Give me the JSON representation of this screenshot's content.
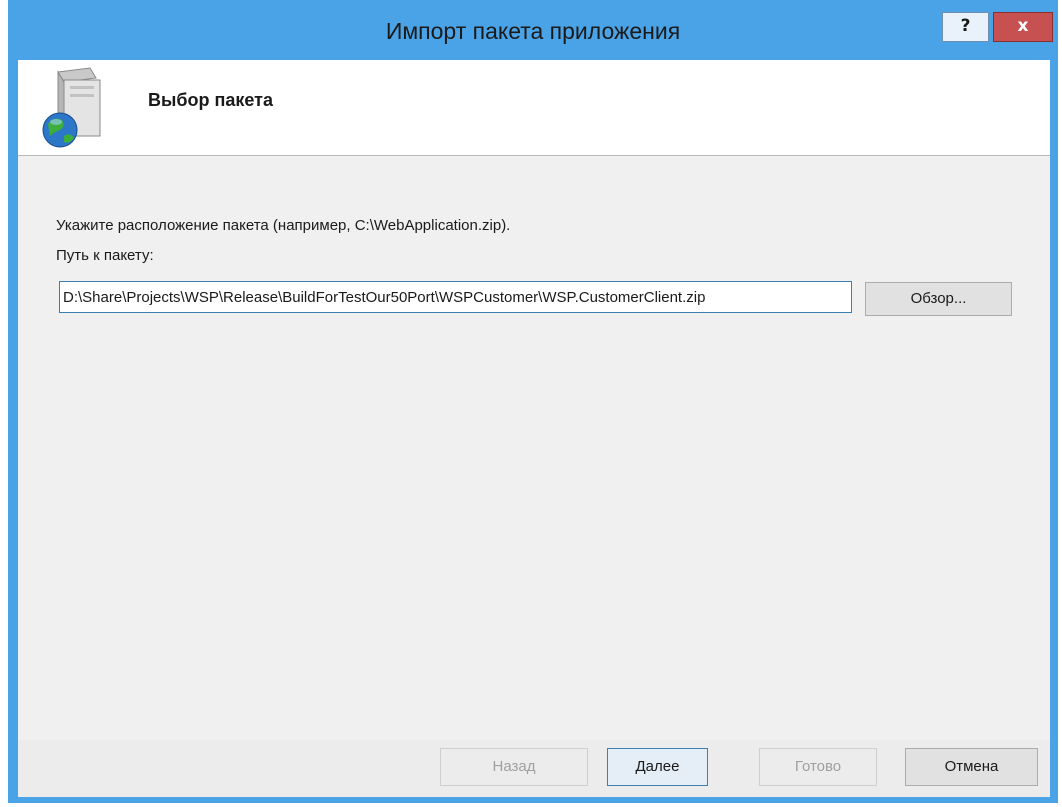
{
  "window": {
    "title": "Импорт пакета приложения",
    "help_label": "?",
    "close_label": "x"
  },
  "header": {
    "title": "Выбор пакета",
    "icon": "package-globe-icon"
  },
  "main": {
    "instruction": "Укажите расположение пакета (например, C:\\WebApplication.zip).",
    "path_label": "Путь к пакету:",
    "path_value": "D:\\Share\\Projects\\WSP\\Release\\BuildForTestOur50Port\\WSPCustomer\\WSP.CustomerClient.zip",
    "browse_label": "Обзор..."
  },
  "footer": {
    "back_label": "Назад",
    "next_label": "Далее",
    "finish_label": "Готово",
    "cancel_label": "Отмена"
  },
  "colors": {
    "frame": "#4aa3e6",
    "close": "#c75050",
    "input_border": "#3c7fb1"
  }
}
